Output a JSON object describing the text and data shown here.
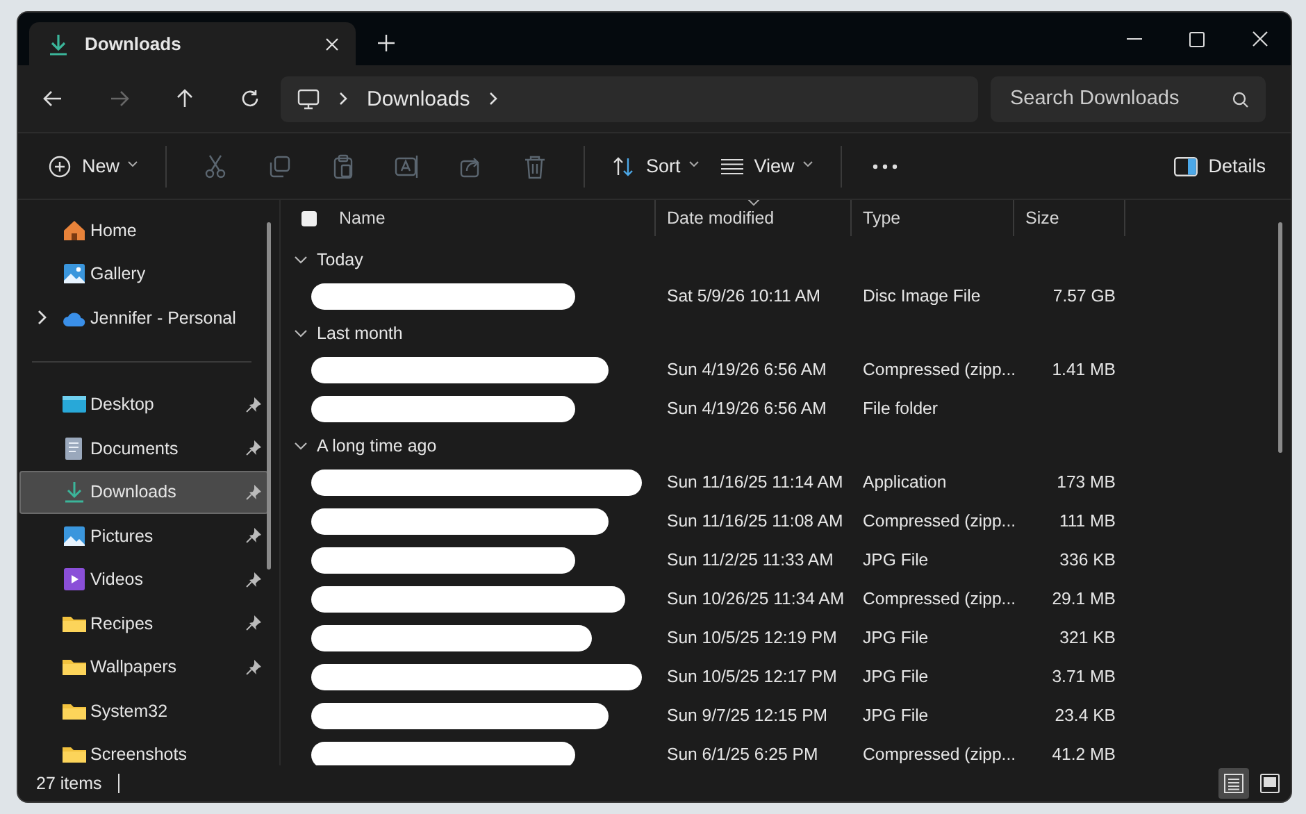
{
  "tab": {
    "title": "Downloads"
  },
  "breadcrumb": [
    "Downloads"
  ],
  "search": {
    "placeholder": "Search Downloads"
  },
  "toolbar": {
    "new": "New",
    "sort": "Sort",
    "view": "View",
    "details": "Details",
    "actions": [
      {
        "kind": "cut",
        "disabled": true
      },
      {
        "kind": "copy",
        "disabled": true
      },
      {
        "kind": "paste",
        "disabled": true
      },
      {
        "kind": "rename",
        "disabled": true
      },
      {
        "kind": "share",
        "disabled": true
      },
      {
        "kind": "delete",
        "disabled": true
      }
    ]
  },
  "sidebar": {
    "top": [
      {
        "kind": "home",
        "label": "Home",
        "selected": false
      },
      {
        "kind": "gallery",
        "label": "Gallery",
        "selected": false
      },
      {
        "kind": "cloud",
        "label": "Jennifer - Personal",
        "selected": false,
        "expanded": false
      }
    ],
    "pinned": [
      {
        "kind": "desktop",
        "label": "Desktop",
        "pinned": true,
        "selected": false
      },
      {
        "kind": "documents",
        "label": "Documents",
        "pinned": true,
        "selected": false
      },
      {
        "kind": "downloads",
        "label": "Downloads",
        "pinned": true,
        "selected": true
      },
      {
        "kind": "pictures",
        "label": "Pictures",
        "pinned": true,
        "selected": false
      },
      {
        "kind": "videos",
        "label": "Videos",
        "pinned": true,
        "selected": false
      },
      {
        "kind": "folder",
        "label": "Recipes",
        "pinned": true,
        "selected": false
      },
      {
        "kind": "folder",
        "label": "Wallpapers",
        "pinned": true,
        "selected": false
      },
      {
        "kind": "folder",
        "label": "System32",
        "pinned": false,
        "selected": false
      },
      {
        "kind": "folder",
        "label": "Screenshots",
        "pinned": false,
        "selected": false
      }
    ]
  },
  "table": {
    "select_all": {
      "checked": false
    },
    "columns": [
      {
        "label": "Name",
        "sorted": false
      },
      {
        "label": "Date modified",
        "sorted": true
      },
      {
        "label": "Type",
        "sorted": false
      },
      {
        "label": "Size",
        "sorted": false
      }
    ],
    "groups": [
      {
        "label": "Today",
        "expanded": true,
        "rows": [
          {
            "date": "Sat 5/9/26 10:11 AM",
            "type": "Disc Image File",
            "size": "7.57 GB"
          }
        ]
      },
      {
        "label": "Last month",
        "expanded": true,
        "rows": [
          {
            "date": "Sun 4/19/26 6:56 AM",
            "type": "Compressed (zipp...",
            "size": "1.41 MB"
          },
          {
            "date": "Sun 4/19/26 6:56 AM",
            "type": "File folder"
          }
        ]
      },
      {
        "label": "A long time ago",
        "expanded": true,
        "rows": [
          {
            "date": "Sun 11/16/25 11:14 AM",
            "type": "Application",
            "size": "173 MB"
          },
          {
            "date": "Sun 11/16/25 11:08 AM",
            "type": "Compressed (zipp...",
            "size": "111 MB"
          },
          {
            "date": "Sun 11/2/25 11:33 AM",
            "type": "JPG File",
            "size": "336 KB"
          },
          {
            "date": "Sun 10/26/25 11:34 AM",
            "type": "Compressed (zipp...",
            "size": "29.1 MB"
          },
          {
            "date": "Sun 10/5/25 12:19 PM",
            "type": "JPG File",
            "size": "321 KB"
          },
          {
            "date": "Sun 10/5/25 12:17 PM",
            "type": "JPG File",
            "size": "3.71 MB"
          },
          {
            "date": "Sun 9/7/25 12:15 PM",
            "type": "JPG File",
            "size": "23.4 KB"
          },
          {
            "date": "Sun 6/1/25 6:25 PM",
            "type": "Compressed (zipp...",
            "size": "41.2 MB"
          }
        ]
      }
    ]
  },
  "status": {
    "count": "27 items"
  },
  "view_toggles": [
    {
      "kind": "details",
      "selected": true
    },
    {
      "kind": "tiles",
      "selected": false
    }
  ]
}
